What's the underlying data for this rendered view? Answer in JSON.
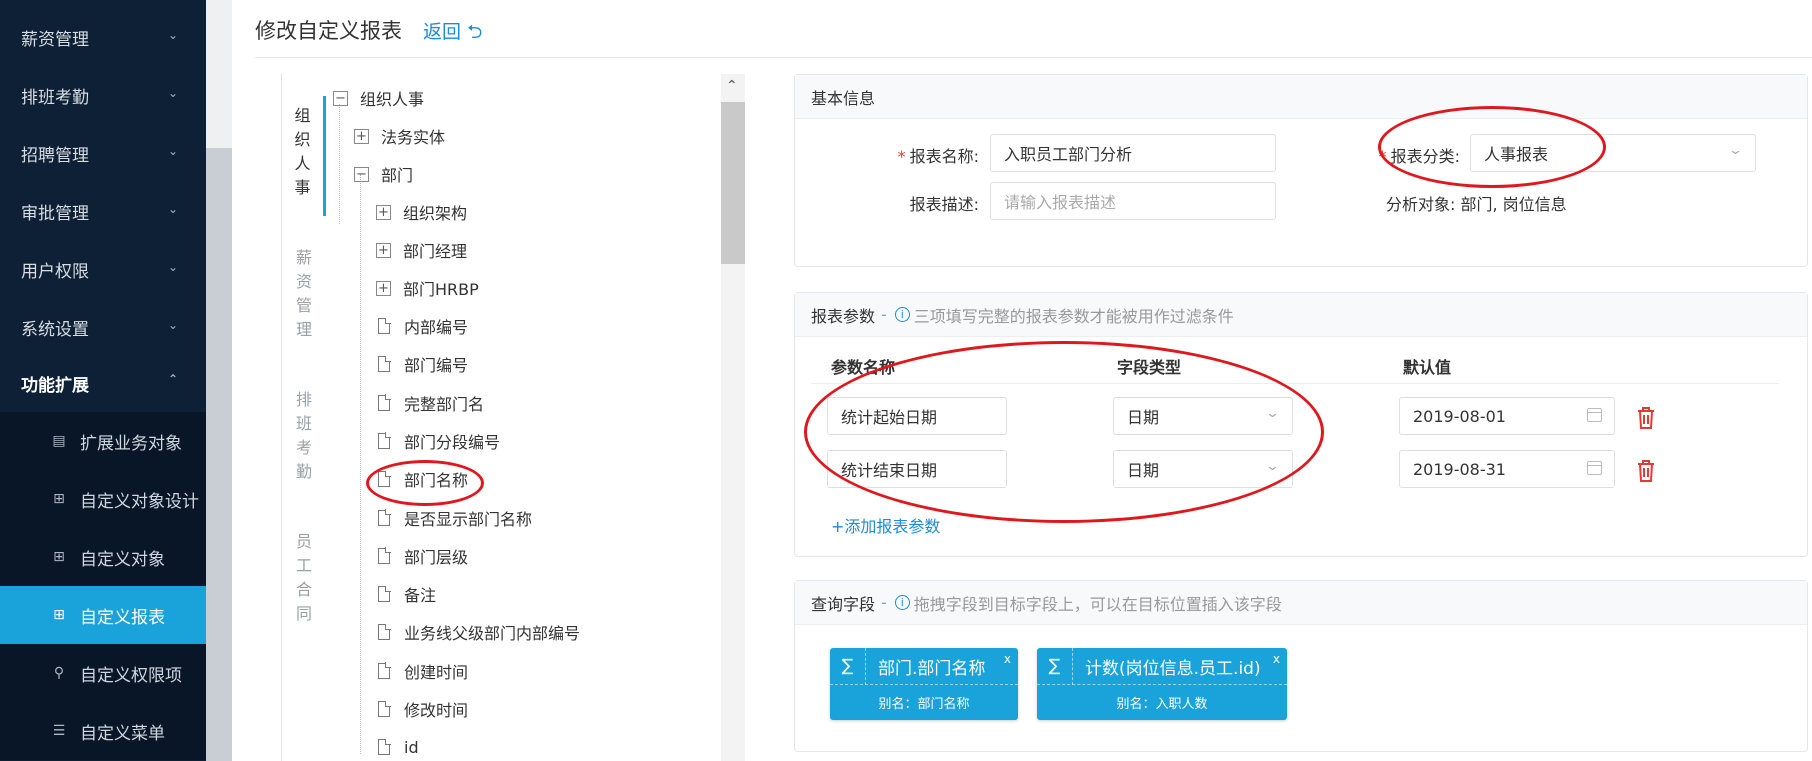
{
  "sidebar": {
    "menus": [
      {
        "label": "薪资管理"
      },
      {
        "label": "排班考勤"
      },
      {
        "label": "招聘管理"
      },
      {
        "label": "审批管理"
      },
      {
        "label": "用户权限"
      },
      {
        "label": "系统设置"
      },
      {
        "label": "功能扩展"
      }
    ],
    "submenus": [
      {
        "label": "扩展业务对象",
        "icon": "list-icon"
      },
      {
        "label": "自定义对象设计",
        "icon": "grid-icon"
      },
      {
        "label": "自定义对象",
        "icon": "grid-icon"
      },
      {
        "label": "自定义报表",
        "icon": "grid-icon"
      },
      {
        "label": "自定义权限项",
        "icon": "user-key-icon"
      },
      {
        "label": "自定义菜单",
        "icon": "menu-list-icon"
      }
    ]
  },
  "header": {
    "title": "修改自定义报表",
    "back": "返回"
  },
  "categories": [
    "组织人事",
    "薪资管理",
    "排班考勤",
    "员工合同"
  ],
  "tree": {
    "root": "组织人事",
    "entity": "法务实体",
    "dept": "部门",
    "dept_children": [
      "组织架构",
      "部门经理",
      "部门HRBP"
    ],
    "dept_fields": [
      "内部编号",
      "部门编号",
      "完整部门名",
      "部门分段编号",
      "部门名称",
      "是否显示部门名称",
      "部门层级",
      "备注",
      "业务线父级部门内部编号",
      "创建时间",
      "修改时间",
      "id"
    ]
  },
  "basic": {
    "section": "基本信息",
    "name_label": "报表名称:",
    "name_value": "入职员工部门分析",
    "desc_label": "报表描述:",
    "desc_placeholder": "请输入报表描述",
    "category_label": "报表分类:",
    "category_value": "人事报表",
    "target_label": "分析对象:",
    "target_value": "部门, 岗位信息"
  },
  "params": {
    "section": "报表参数",
    "hint": "三项填写完整的报表参数才能被用作过滤条件",
    "col_name": "参数名称",
    "col_type": "字段类型",
    "col_default": "默认值",
    "rows": [
      {
        "name": "统计起始日期",
        "type": "日期",
        "default": "2019-08-01"
      },
      {
        "name": "统计结束日期",
        "type": "日期",
        "default": "2019-08-31"
      }
    ],
    "add": "+添加报表参数"
  },
  "query": {
    "section": "查询字段",
    "hint": "拖拽字段到目标字段上，可以在目标位置插入该字段",
    "fields": [
      {
        "name": "部门.部门名称",
        "alias": "别名：部门名称"
      },
      {
        "name": "计数(岗位信息.员工.id)",
        "alias": "别名：入职人数"
      }
    ]
  },
  "theme": {
    "accent": "#1aa3db",
    "sidebar_bg": "#0d2035",
    "annotation": "#e0181e"
  }
}
